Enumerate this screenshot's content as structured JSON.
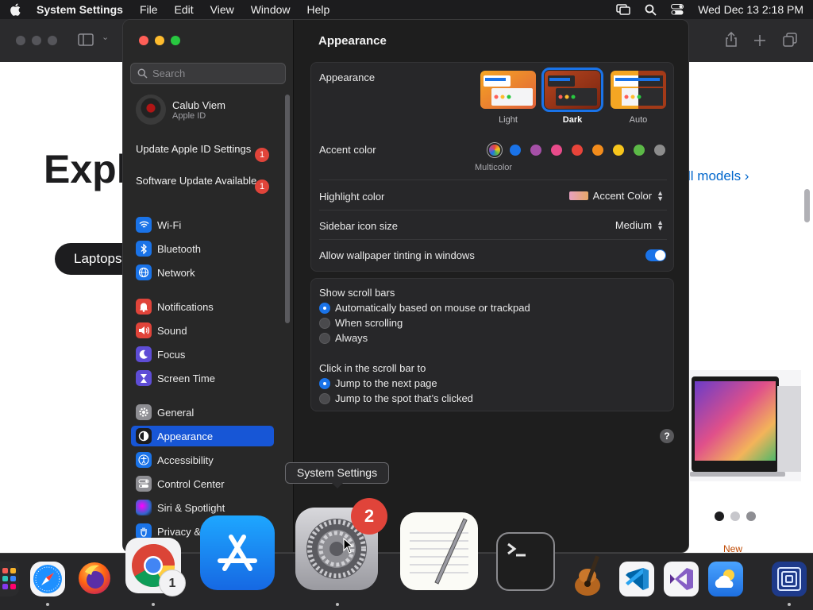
{
  "menubar": {
    "app": "System Settings",
    "items": [
      "File",
      "Edit",
      "View",
      "Window",
      "Help"
    ],
    "datetime": "Wed Dec 13  2:18 PM"
  },
  "safari_bg": {
    "headline": "Expl",
    "pill_label": "Laptops",
    "models_link": "ll models ›",
    "new_label": "New"
  },
  "sidebar": {
    "search_placeholder": "Search",
    "user_name": "Calub Viem",
    "user_sub": "Apple ID",
    "notices": [
      {
        "label": "Update Apple ID Settings",
        "count": "1"
      },
      {
        "label": "Software Update Available",
        "count": "1"
      }
    ],
    "items": [
      {
        "label": "Wi-Fi",
        "icon": "wifi-icon",
        "color": "#1a73e8"
      },
      {
        "label": "Bluetooth",
        "icon": "bluetooth-icon",
        "color": "#1a73e8"
      },
      {
        "label": "Network",
        "icon": "globe-icon",
        "color": "#1a73e8"
      },
      {
        "label": "Notifications",
        "icon": "bell-icon",
        "color": "#e0443a"
      },
      {
        "label": "Sound",
        "icon": "speaker-icon",
        "color": "#e0443a"
      },
      {
        "label": "Focus",
        "icon": "moon-icon",
        "color": "#5e4dd6"
      },
      {
        "label": "Screen Time",
        "icon": "hourglass-icon",
        "color": "#5e4dd6"
      },
      {
        "label": "General",
        "icon": "gear-icon",
        "color": "#8e8e93"
      },
      {
        "label": "Appearance",
        "icon": "appearance-icon",
        "color": "#1c1c1e"
      },
      {
        "label": "Accessibility",
        "icon": "accessibility-icon",
        "color": "#1a73e8"
      },
      {
        "label": "Control Center",
        "icon": "control-center-icon",
        "color": "#8e8e93"
      },
      {
        "label": "Siri & Spotlight",
        "icon": "siri-icon",
        "color": "#b14bd6"
      },
      {
        "label": "Privacy &",
        "icon": "hand-icon",
        "color": "#1a73e8"
      }
    ]
  },
  "appearance": {
    "title": "Appearance",
    "row_label": "Appearance",
    "options": [
      "Light",
      "Dark",
      "Auto"
    ],
    "selected": "Dark",
    "accent_label": "Accent color",
    "accent_colors": [
      "#1a73e8",
      "#a550a7",
      "#e84b8a",
      "#e8443a",
      "#f28c1c",
      "#f7c51c",
      "#5cb947",
      "#8c8c8c"
    ],
    "accent_selected_label": "Multicolor",
    "highlight_label": "Highlight color",
    "highlight_value": "Accent Color",
    "icon_size_label": "Sidebar icon size",
    "icon_size_value": "Medium",
    "tinting_label": "Allow wallpaper tinting in windows",
    "tinting_on": true,
    "scroll_label": "Show scroll bars",
    "scroll_options": [
      "Automatically based on mouse or trackpad",
      "When scrolling",
      "Always"
    ],
    "click_label": "Click in the scroll bar to",
    "click_options": [
      "Jump to the next page",
      "Jump to the spot that’s clicked"
    ],
    "help": "?"
  },
  "tooltip": "System Settings",
  "dock": {
    "chrome_badge": "1",
    "settings_badge": "2"
  }
}
